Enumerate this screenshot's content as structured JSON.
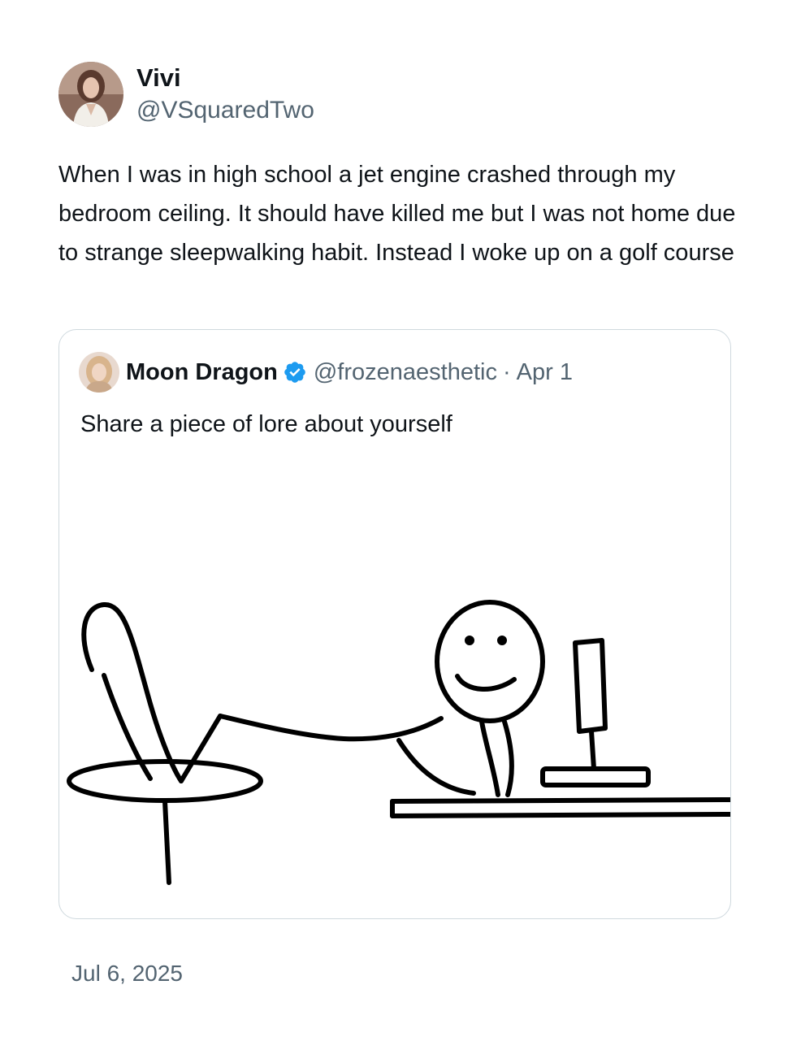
{
  "author": {
    "display_name": "Vivi",
    "handle": "@VSquaredTwo",
    "avatar_icon": "profile-photo"
  },
  "tweet": {
    "text": "When I was in high school a jet engine crashed through my bedroom ceiling. It should have killed me but I was not home due to strange sleepwalking habit. Instead I woke up on a golf course"
  },
  "quoted_tweet": {
    "display_name": "Moon Dragon",
    "verified": true,
    "verified_icon": "verified-badge-icon",
    "handle": "@frozenaesthetic",
    "separator": "·",
    "date": "Apr 1",
    "text": "Share a piece of lore about yourself",
    "media_description_icon": "stick-figure-at-computer-drawing"
  },
  "timestamp": "Jul 6, 2025",
  "colors": {
    "text_primary": "#0f1419",
    "text_secondary": "#536471",
    "border": "#cfd9de",
    "verified_blue": "#1d9bf0"
  }
}
